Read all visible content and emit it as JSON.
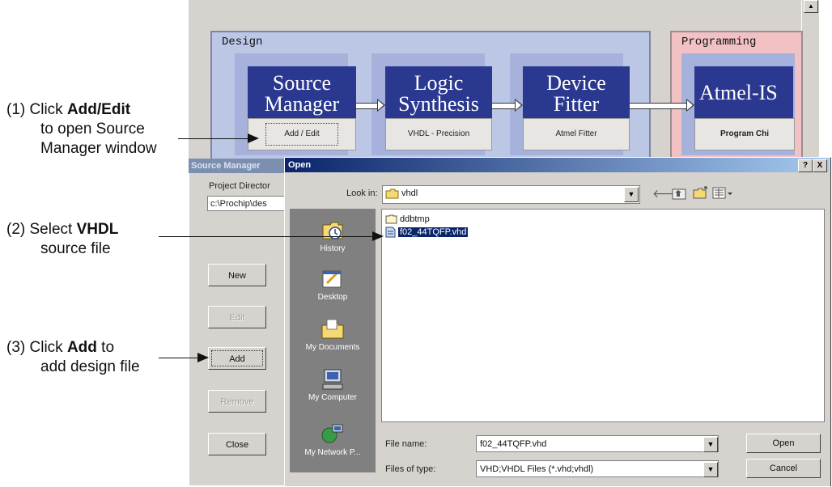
{
  "callouts": {
    "c1": {
      "line1_pre": "(1) Click ",
      "line1_bold": "Add/Edit",
      "line2": "to open Source",
      "line3": "Manager window"
    },
    "c2": {
      "line1_pre": "(2) Select ",
      "line1_bold": "VHDL",
      "line2": "source file"
    },
    "c3": {
      "line1_pre": "(3) Click ",
      "line1_bold": "Add",
      "line1_post": " to",
      "line2": "add design file"
    }
  },
  "project_window": {
    "design_group_label": "Design",
    "programming_group_label": "Programming",
    "steps": [
      {
        "title_l1": "Source",
        "title_l2": "Manager",
        "button": "Add / Edit"
      },
      {
        "title_l1": "Logic",
        "title_l2": "Synthesis",
        "button": "VHDL - Precision"
      },
      {
        "title_l1": "Device",
        "title_l2": "Fitter",
        "button": "Atmel Fitter"
      },
      {
        "title_l1": "Atmel-IS",
        "button": "Program Chi"
      }
    ]
  },
  "source_manager": {
    "title": "Source Manager",
    "project_directory_label": "Project Director",
    "project_directory_value": "c:\\Prochip\\des",
    "buttons": {
      "new": "New",
      "edit": "Edit",
      "add": "Add",
      "remove": "Remove",
      "close": "Close"
    }
  },
  "open_dialog": {
    "title": "Open",
    "help_btn": "?",
    "close_btn": "X",
    "look_in_label": "Look in:",
    "look_in_value": "vhdl",
    "places": [
      "History",
      "Desktop",
      "My Documents",
      "My Computer",
      "My Network P..."
    ],
    "files": [
      {
        "name": "ddbtmp",
        "type": "folder"
      },
      {
        "name": "f02_44TQFP.vhd",
        "type": "file",
        "selected": true
      }
    ],
    "file_name_label": "File name:",
    "file_name_value": "f02_44TQFP.vhd",
    "file_type_label": "Files of type:",
    "file_type_value": "VHD;VHDL Files (*.vhd;vhdl)",
    "open_button": "Open",
    "cancel_button": "Cancel"
  },
  "icons": [
    "back-arrow-icon",
    "up-folder-icon",
    "new-folder-icon",
    "view-menu-icon",
    "folder-icon",
    "vhd-file-icon",
    "history-icon",
    "desktop-icon",
    "my-documents-icon",
    "my-computer-icon",
    "my-network-icon"
  ],
  "colors": {
    "step_block": "#2a3890",
    "design_group": "#bcc7e6",
    "programming_group": "#f1c1c4",
    "title_bar": "#0a246a",
    "selection": "#0a246a"
  }
}
